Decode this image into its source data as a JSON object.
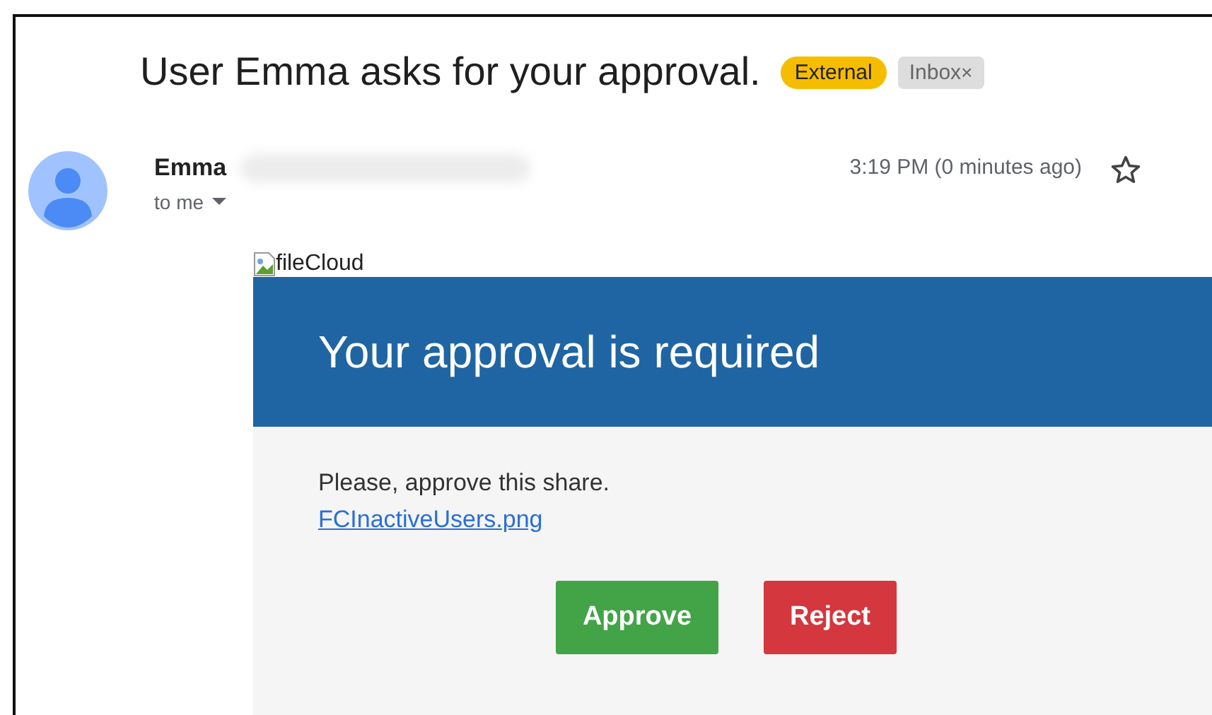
{
  "subject": "User Emma asks for your approval.",
  "labels": [
    {
      "text": "External",
      "kind": "external"
    },
    {
      "text": "Inbox",
      "kind": "inbox",
      "remove": "×"
    }
  ],
  "sender": {
    "name": "Emma",
    "recipient": "to me",
    "time": "3:19 PM (0 minutes ago)",
    "starred": false
  },
  "body": {
    "logo_alt": "fileCloud",
    "banner": "Your approval is required",
    "message": "Please, approve this share.",
    "link": "FCInactiveUsers.png",
    "buttons": [
      {
        "label": "Approve",
        "kind": "approve"
      },
      {
        "label": "Reject",
        "kind": "reject"
      }
    ]
  }
}
